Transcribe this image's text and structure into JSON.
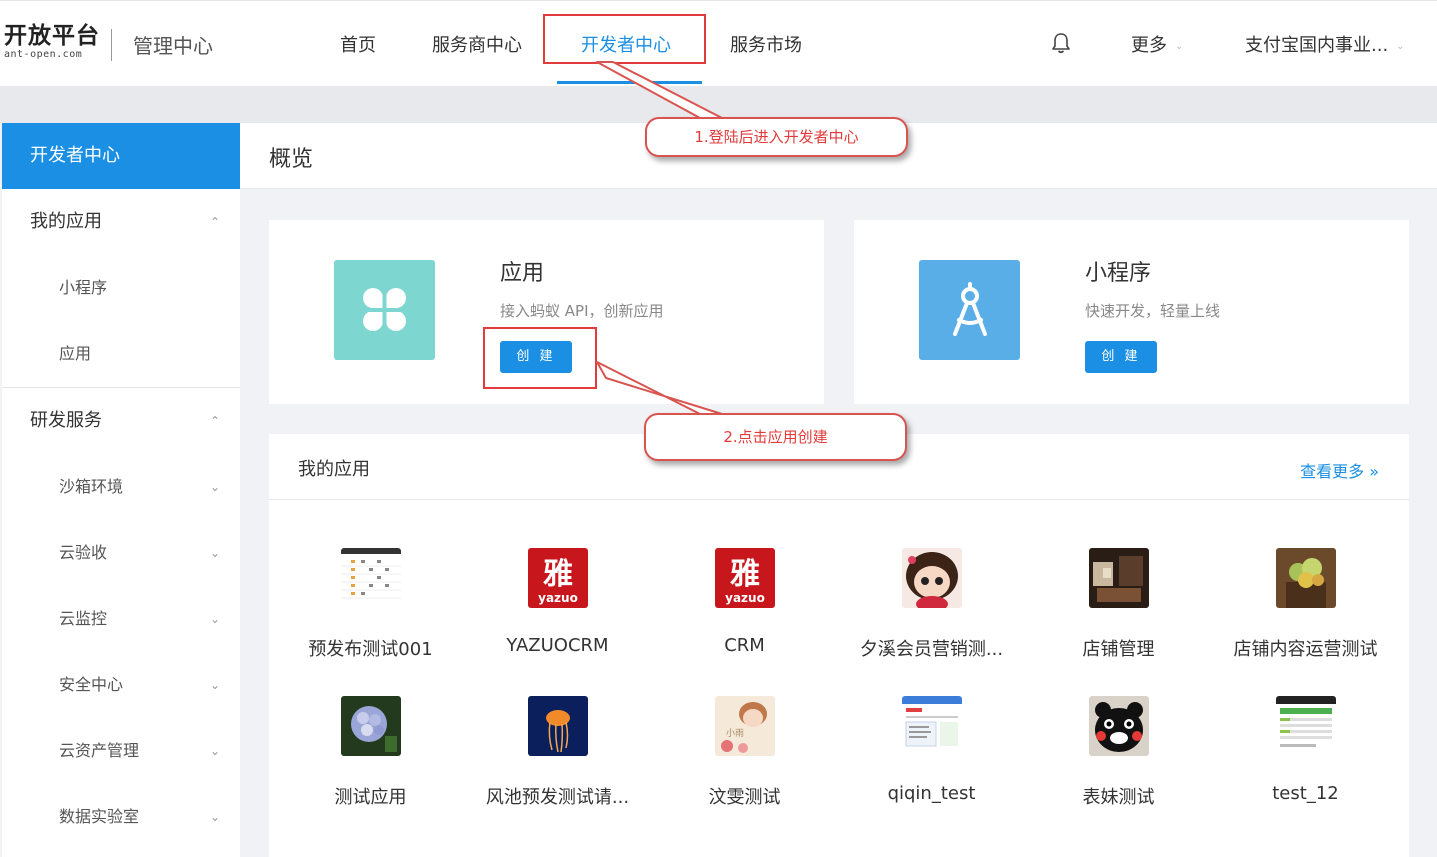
{
  "header": {
    "logo_main": "开放平台",
    "logo_sub": "ant-open.com",
    "logo_title": "管理中心",
    "nav": [
      "首页",
      "服务商中心",
      "开发者中心",
      "服务市场"
    ],
    "active_nav": "开发者中心",
    "more_label": "更多",
    "account_label": "支付宝国内事业..."
  },
  "sidebar": {
    "active": "开发者中心",
    "group1": "我的应用",
    "group1_items": [
      "小程序",
      "应用"
    ],
    "group2": "研发服务",
    "group2_items": [
      "沙箱环境",
      "云验收",
      "云监控",
      "安全中心",
      "云资产管理",
      "数据实验室"
    ]
  },
  "main": {
    "title": "概览",
    "card_app": {
      "title": "应用",
      "desc": "接入蚂蚁 API，创新应用",
      "button": "创 建"
    },
    "card_mini": {
      "title": "小程序",
      "desc": "快速开发，轻量上线",
      "button": "创 建"
    }
  },
  "my_apps": {
    "title": "我的应用",
    "more": "查看更多 »",
    "items": [
      {
        "name": "预发布测试001",
        "icon": "spreadsheet-thumb"
      },
      {
        "name": "YAZUOCRM",
        "icon": "yazuo-logo"
      },
      {
        "name": "CRM",
        "icon": "yazuo-logo"
      },
      {
        "name": "夕溪会员营销测...",
        "icon": "cartoon-girl"
      },
      {
        "name": "店铺管理",
        "icon": "shop-photo"
      },
      {
        "name": "店铺内容运营测试",
        "icon": "succulent-photo"
      },
      {
        "name": "测试应用",
        "icon": "hydrangea-photo"
      },
      {
        "name": "风池预发测试请...",
        "icon": "jellyfish-photo"
      },
      {
        "name": "汶雯测试",
        "icon": "illustration-girl"
      },
      {
        "name": "qiqin_test",
        "icon": "webpage-thumb"
      },
      {
        "name": "表妹测试",
        "icon": "kumamon"
      },
      {
        "name": "test_12",
        "icon": "phone-screen-thumb"
      }
    ]
  },
  "annotations": {
    "step1": "1.登陆后进入开发者中心",
    "step2": "2.点击应用创建"
  },
  "colors": {
    "accent": "#1a8fe3",
    "app_icon": "#7dd6cf",
    "mini_icon": "#5aaee8",
    "annotation": "#e23b3b"
  }
}
